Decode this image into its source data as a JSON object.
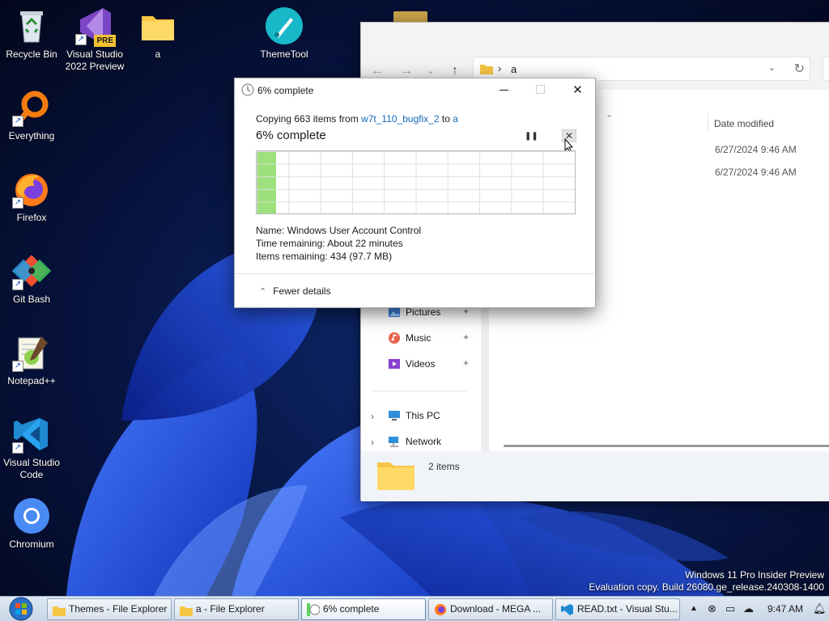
{
  "desktop": {
    "icons": [
      {
        "label": "Recycle Bin",
        "icon": "recycle-bin-icon"
      },
      {
        "label": "Visual Studio 2022 Preview",
        "icon": "visual-studio-preview-icon",
        "badge": "PRE"
      },
      {
        "label": "a",
        "icon": "folder-icon"
      },
      {
        "label": "ThemeTool",
        "icon": "theme-tool-icon"
      },
      {
        "label": "Everything",
        "icon": "everything-search-icon"
      },
      {
        "label": "Firefox",
        "icon": "firefox-icon"
      },
      {
        "label": "Git Bash",
        "icon": "git-bash-icon"
      },
      {
        "label": "Notepad++",
        "icon": "notepad-plus-plus-icon"
      },
      {
        "label": "Visual Studio Code",
        "icon": "vscode-icon"
      },
      {
        "label": "Chromium",
        "icon": "chromium-icon"
      }
    ],
    "watermark_line1": "Windows 11 Pro Insider Preview",
    "watermark_line2": "Evaluation copy. Build 26080.ge_release.240308-1400"
  },
  "explorer": {
    "breadcrumb": "a",
    "columns": {
      "date_modified": "Date modified"
    },
    "rows": [
      {
        "date": "6/27/2024 9:46 AM"
      },
      {
        "date": "6/27/2024 9:46 AM"
      }
    ],
    "nav": [
      {
        "label": "Pictures",
        "icon": "pictures-icon",
        "pinned": true
      },
      {
        "label": "Music",
        "icon": "music-icon",
        "pinned": true
      },
      {
        "label": "Videos",
        "icon": "videos-icon",
        "pinned": true
      },
      {
        "label": "This PC",
        "icon": "this-pc-icon"
      },
      {
        "label": "Network",
        "icon": "network-icon"
      }
    ],
    "status": "2 items"
  },
  "dialog": {
    "title": "6% complete",
    "copy_prefix": "Copying 663 items from ",
    "source": "w7t_110_bugfix_2",
    "copy_mid": " to ",
    "dest": "a",
    "heading": "6% complete",
    "progress_percent": 6,
    "details": {
      "name_label": "Name:",
      "name_value": "Windows User Account Control",
      "time_label": "Time remaining:",
      "time_value": "About 22 minutes",
      "items_label": "Items remaining:",
      "items_value": "434 (97.7 MB)"
    },
    "fewer_details": "Fewer details"
  },
  "taskbar": {
    "buttons": [
      {
        "label": "Themes - File Explorer",
        "icon": "folder-icon"
      },
      {
        "label": "a - File Explorer",
        "icon": "folder-icon"
      },
      {
        "label": "6% complete",
        "icon": "copy-progress-icon"
      },
      {
        "label": "Download - MEGA ...",
        "icon": "firefox-icon"
      },
      {
        "label": "READ.txt - Visual Stu...",
        "icon": "vscode-icon"
      }
    ],
    "clock": "9:47 AM"
  }
}
